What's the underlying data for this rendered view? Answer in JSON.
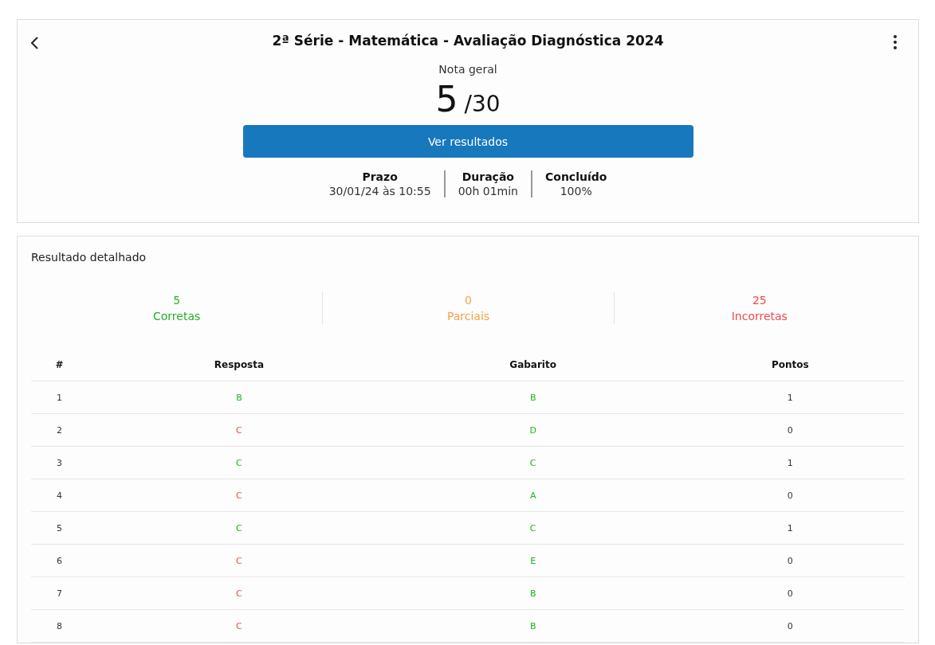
{
  "header": {
    "title": "2ª Série - Matemática - Avaliação Diagnóstica 2024",
    "score_label": "Nota geral",
    "score": "5",
    "score_total": "/30",
    "button": "Ver resultados",
    "stats": [
      {
        "label": "Prazo",
        "value": "30/01/24 às 10:55"
      },
      {
        "label": "Duração",
        "value": "00h 01min"
      },
      {
        "label": "Concluído",
        "value": "100%"
      }
    ]
  },
  "detail": {
    "title": "Resultado detalhado",
    "summary": [
      {
        "count": "5",
        "label": "Corretas",
        "color": "#22b022"
      },
      {
        "count": "0",
        "label": "Parciais",
        "color": "#f5a04a"
      },
      {
        "count": "25",
        "label": "Incorretas",
        "color": "#f04a4a"
      }
    ],
    "table": {
      "columns": [
        "#",
        "Resposta",
        "Gabarito",
        "Pontos"
      ],
      "rows": [
        {
          "number": "1",
          "answer": "B",
          "key": "B",
          "points": "1",
          "correct": true
        },
        {
          "number": "2",
          "answer": "C",
          "key": "D",
          "points": "0",
          "correct": false
        },
        {
          "number": "3",
          "answer": "C",
          "key": "C",
          "points": "1",
          "correct": true
        },
        {
          "number": "4",
          "answer": "C",
          "key": "A",
          "points": "0",
          "correct": false
        },
        {
          "number": "5",
          "answer": "C",
          "key": "C",
          "points": "1",
          "correct": true
        },
        {
          "number": "6",
          "answer": "C",
          "key": "E",
          "points": "0",
          "correct": false
        },
        {
          "number": "7",
          "answer": "C",
          "key": "B",
          "points": "0",
          "correct": false
        },
        {
          "number": "8",
          "answer": "C",
          "key": "B",
          "points": "0",
          "correct": false
        }
      ]
    }
  }
}
